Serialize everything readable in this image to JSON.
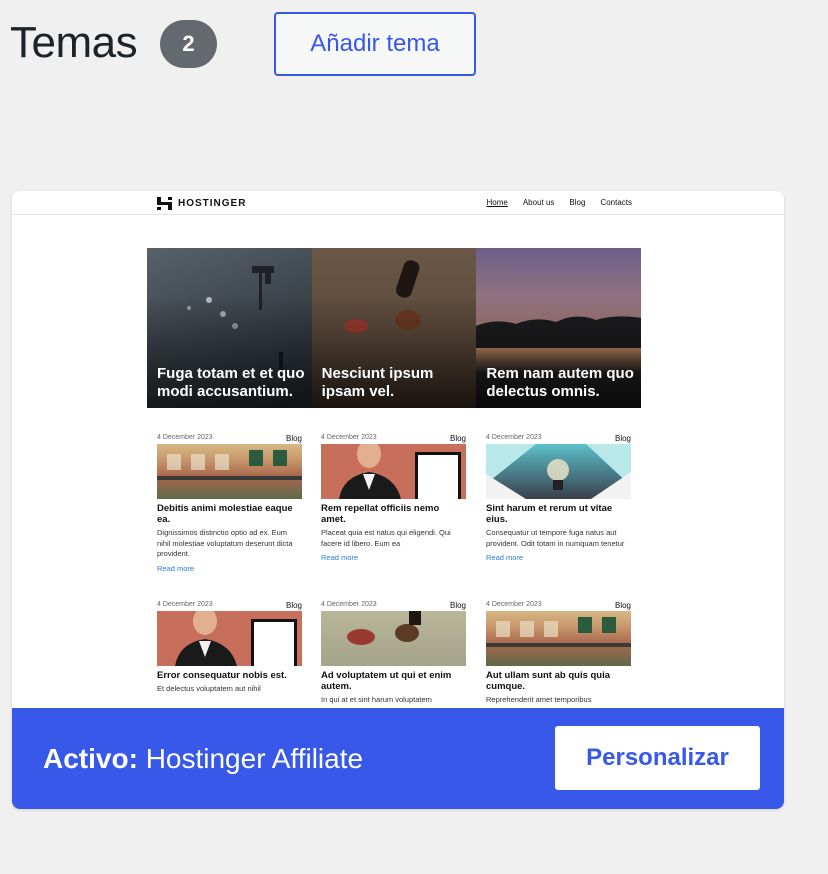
{
  "header": {
    "title": "Temas",
    "count": "2",
    "add_button": "Añadir tema"
  },
  "theme": {
    "active_prefix": "Activo:",
    "active_name": "Hostinger Affiliate",
    "customize_button": "Personalizar",
    "accent_color": "#3858e9"
  },
  "preview": {
    "logo_text": "HOSTINGER",
    "nav": [
      "Home",
      "About us",
      "Blog",
      "Contacts"
    ],
    "hero": [
      {
        "title": "Fuga totam et et quo modi accusantium."
      },
      {
        "title": "Nesciunt ipsum ipsam vel."
      },
      {
        "title": "Rem nam autem quo delectus omnis."
      }
    ],
    "posts": [
      {
        "date": "4 December 2023",
        "category": "Blog",
        "title": "Debitis animi molestiae eaque ea.",
        "excerpt": "Dignissimos distinctio optio ad ex. Eum nihil molestiae voluptatum deserunt dicta provident.",
        "read_more": "Read more"
      },
      {
        "date": "4 December 2023",
        "category": "Blog",
        "title": "Rem repellat officiis nemo amet.",
        "excerpt": "Placeat quia est natus qui eligendi. Qui facere id libero. Eum ea",
        "read_more": "Read more"
      },
      {
        "date": "4 December 2023",
        "category": "Blog",
        "title": "Sint harum et rerum ut vitae eius.",
        "excerpt": "Consequatur ut tempore fuga natus aut provident. Odit totam in numquam tenetur",
        "read_more": "Read more"
      },
      {
        "date": "4 December 2023",
        "category": "Blog",
        "title": "Error consequatur nobis est.",
        "excerpt": "Et delectus voluptatem aut nihil",
        "read_more": ""
      },
      {
        "date": "4 December 2023",
        "category": "Blog",
        "title": "Ad voluptatem ut qui et enim autem.",
        "excerpt": "In qui at et sint harum voluptatem",
        "read_more": ""
      },
      {
        "date": "4 December 2023",
        "category": "Blog",
        "title": "Aut ullam sunt ab quis quia cumque.",
        "excerpt": "Reprehenderit amet temporibus",
        "read_more": ""
      }
    ]
  }
}
